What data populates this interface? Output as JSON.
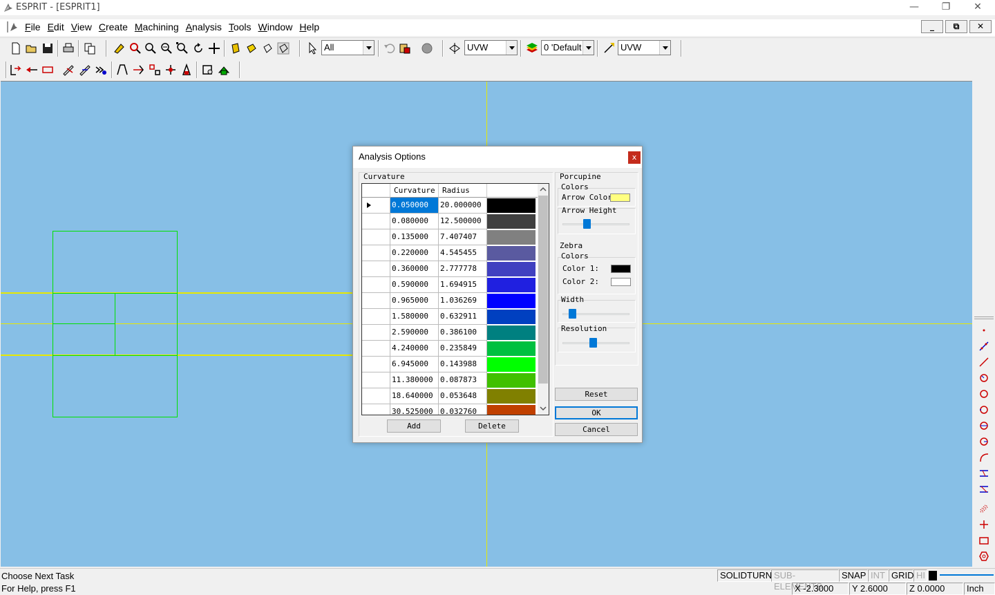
{
  "window": {
    "title": "ESPRIT - [ESPRIT1]",
    "min": "—",
    "restore": "❐",
    "close": "✕"
  },
  "menu": [
    "File",
    "Edit",
    "View",
    "Create",
    "Machining",
    "Analysis",
    "Tools",
    "Window",
    "Help"
  ],
  "mdi": {
    "min": "_",
    "restore": "⧉",
    "close": "✕"
  },
  "toolbar": {
    "select_filter": "All",
    "workplane": "UVW",
    "layer": "0 'Default",
    "view_plane": "UVW"
  },
  "status": {
    "prompt": "Choose Next Task",
    "help": "For Help, press F1",
    "modes": [
      "SOLIDTURN",
      "SUB-ELEMENTS",
      "SNAP",
      "INT",
      "GRID",
      "HI"
    ],
    "x": "X -2.3000",
    "y": "Y 2.6000",
    "z": "Z 0.0000",
    "units": "Inch"
  },
  "dialog": {
    "title": "Analysis Options",
    "close": "x",
    "curvature_group": "Curvature",
    "columns": [
      "Curvature",
      "Radius"
    ],
    "rows": [
      {
        "curvature": "0.050000",
        "radius": "20.000000",
        "color": "#000000"
      },
      {
        "curvature": "0.080000",
        "radius": "12.500000",
        "color": "#404040"
      },
      {
        "curvature": "0.135000",
        "radius": "7.407407",
        "color": "#808080"
      },
      {
        "curvature": "0.220000",
        "radius": "4.545455",
        "color": "#5a5aa0"
      },
      {
        "curvature": "0.360000",
        "radius": "2.777778",
        "color": "#4040c0"
      },
      {
        "curvature": "0.590000",
        "radius": "1.694915",
        "color": "#2020e0"
      },
      {
        "curvature": "0.965000",
        "radius": "1.036269",
        "color": "#0000ff"
      },
      {
        "curvature": "1.580000",
        "radius": "0.632911",
        "color": "#0040c0"
      },
      {
        "curvature": "2.590000",
        "radius": "0.386100",
        "color": "#008080"
      },
      {
        "curvature": "4.240000",
        "radius": "0.235849",
        "color": "#00c040"
      },
      {
        "curvature": "6.945000",
        "radius": "0.143988",
        "color": "#00ff00"
      },
      {
        "curvature": "11.380000",
        "radius": "0.087873",
        "color": "#40c000"
      },
      {
        "curvature": "18.640000",
        "radius": "0.053648",
        "color": "#808000"
      },
      {
        "curvature": "30.525000",
        "radius": "0.032760",
        "color": "#c04000"
      }
    ],
    "add": "Add",
    "delete": "Delete",
    "porcupine": {
      "group": "Porcupine",
      "colors": "Colors",
      "arrow_color": "Arrow Color",
      "arrow_color_value": "#ffff80",
      "arrow_height": "Arrow Height",
      "arrow_height_level": 0.35
    },
    "zebra": {
      "group": "Zebra",
      "colors": "Colors",
      "color1": "Color 1:",
      "color1_value": "#000000",
      "color2": "Color 2:",
      "color2_value": "#ffffff",
      "width": "Width",
      "width_level": 0.1,
      "resolution": "Resolution",
      "resolution_level": 0.45
    },
    "reset": "Reset",
    "ok": "OK",
    "cancel": "Cancel"
  }
}
